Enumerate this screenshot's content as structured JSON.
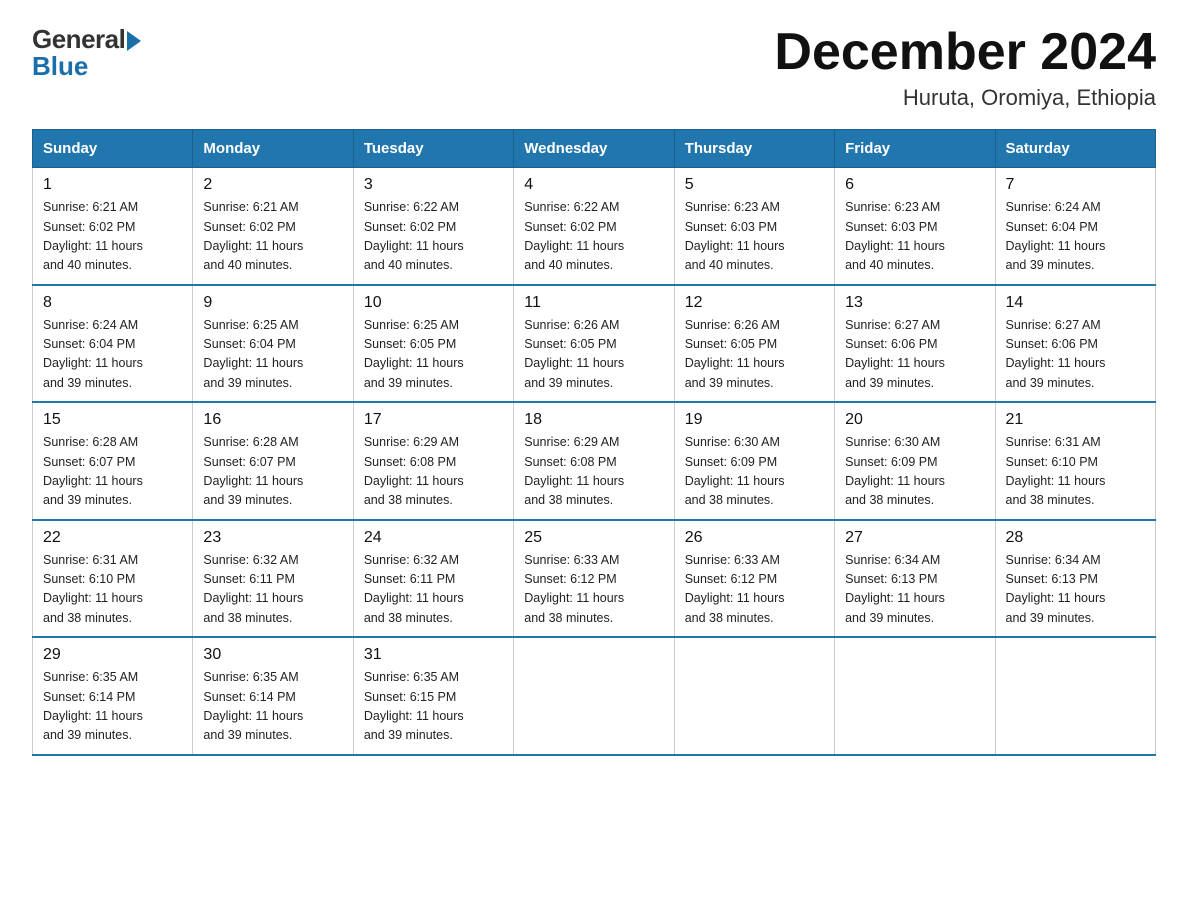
{
  "header": {
    "logo_general": "General",
    "logo_blue": "Blue",
    "month_title": "December 2024",
    "location": "Huruta, Oromiya, Ethiopia"
  },
  "days_of_week": [
    "Sunday",
    "Monday",
    "Tuesday",
    "Wednesday",
    "Thursday",
    "Friday",
    "Saturday"
  ],
  "weeks": [
    [
      {
        "day": "1",
        "sunrise": "6:21 AM",
        "sunset": "6:02 PM",
        "daylight": "11 hours and 40 minutes."
      },
      {
        "day": "2",
        "sunrise": "6:21 AM",
        "sunset": "6:02 PM",
        "daylight": "11 hours and 40 minutes."
      },
      {
        "day": "3",
        "sunrise": "6:22 AM",
        "sunset": "6:02 PM",
        "daylight": "11 hours and 40 minutes."
      },
      {
        "day": "4",
        "sunrise": "6:22 AM",
        "sunset": "6:02 PM",
        "daylight": "11 hours and 40 minutes."
      },
      {
        "day": "5",
        "sunrise": "6:23 AM",
        "sunset": "6:03 PM",
        "daylight": "11 hours and 40 minutes."
      },
      {
        "day": "6",
        "sunrise": "6:23 AM",
        "sunset": "6:03 PM",
        "daylight": "11 hours and 40 minutes."
      },
      {
        "day": "7",
        "sunrise": "6:24 AM",
        "sunset": "6:04 PM",
        "daylight": "11 hours and 39 minutes."
      }
    ],
    [
      {
        "day": "8",
        "sunrise": "6:24 AM",
        "sunset": "6:04 PM",
        "daylight": "11 hours and 39 minutes."
      },
      {
        "day": "9",
        "sunrise": "6:25 AM",
        "sunset": "6:04 PM",
        "daylight": "11 hours and 39 minutes."
      },
      {
        "day": "10",
        "sunrise": "6:25 AM",
        "sunset": "6:05 PM",
        "daylight": "11 hours and 39 minutes."
      },
      {
        "day": "11",
        "sunrise": "6:26 AM",
        "sunset": "6:05 PM",
        "daylight": "11 hours and 39 minutes."
      },
      {
        "day": "12",
        "sunrise": "6:26 AM",
        "sunset": "6:05 PM",
        "daylight": "11 hours and 39 minutes."
      },
      {
        "day": "13",
        "sunrise": "6:27 AM",
        "sunset": "6:06 PM",
        "daylight": "11 hours and 39 minutes."
      },
      {
        "day": "14",
        "sunrise": "6:27 AM",
        "sunset": "6:06 PM",
        "daylight": "11 hours and 39 minutes."
      }
    ],
    [
      {
        "day": "15",
        "sunrise": "6:28 AM",
        "sunset": "6:07 PM",
        "daylight": "11 hours and 39 minutes."
      },
      {
        "day": "16",
        "sunrise": "6:28 AM",
        "sunset": "6:07 PM",
        "daylight": "11 hours and 39 minutes."
      },
      {
        "day": "17",
        "sunrise": "6:29 AM",
        "sunset": "6:08 PM",
        "daylight": "11 hours and 38 minutes."
      },
      {
        "day": "18",
        "sunrise": "6:29 AM",
        "sunset": "6:08 PM",
        "daylight": "11 hours and 38 minutes."
      },
      {
        "day": "19",
        "sunrise": "6:30 AM",
        "sunset": "6:09 PM",
        "daylight": "11 hours and 38 minutes."
      },
      {
        "day": "20",
        "sunrise": "6:30 AM",
        "sunset": "6:09 PM",
        "daylight": "11 hours and 38 minutes."
      },
      {
        "day": "21",
        "sunrise": "6:31 AM",
        "sunset": "6:10 PM",
        "daylight": "11 hours and 38 minutes."
      }
    ],
    [
      {
        "day": "22",
        "sunrise": "6:31 AM",
        "sunset": "6:10 PM",
        "daylight": "11 hours and 38 minutes."
      },
      {
        "day": "23",
        "sunrise": "6:32 AM",
        "sunset": "6:11 PM",
        "daylight": "11 hours and 38 minutes."
      },
      {
        "day": "24",
        "sunrise": "6:32 AM",
        "sunset": "6:11 PM",
        "daylight": "11 hours and 38 minutes."
      },
      {
        "day": "25",
        "sunrise": "6:33 AM",
        "sunset": "6:12 PM",
        "daylight": "11 hours and 38 minutes."
      },
      {
        "day": "26",
        "sunrise": "6:33 AM",
        "sunset": "6:12 PM",
        "daylight": "11 hours and 38 minutes."
      },
      {
        "day": "27",
        "sunrise": "6:34 AM",
        "sunset": "6:13 PM",
        "daylight": "11 hours and 39 minutes."
      },
      {
        "day": "28",
        "sunrise": "6:34 AM",
        "sunset": "6:13 PM",
        "daylight": "11 hours and 39 minutes."
      }
    ],
    [
      {
        "day": "29",
        "sunrise": "6:35 AM",
        "sunset": "6:14 PM",
        "daylight": "11 hours and 39 minutes."
      },
      {
        "day": "30",
        "sunrise": "6:35 AM",
        "sunset": "6:14 PM",
        "daylight": "11 hours and 39 minutes."
      },
      {
        "day": "31",
        "sunrise": "6:35 AM",
        "sunset": "6:15 PM",
        "daylight": "11 hours and 39 minutes."
      },
      null,
      null,
      null,
      null
    ]
  ],
  "labels": {
    "sunrise": "Sunrise:",
    "sunset": "Sunset:",
    "daylight": "Daylight:"
  }
}
